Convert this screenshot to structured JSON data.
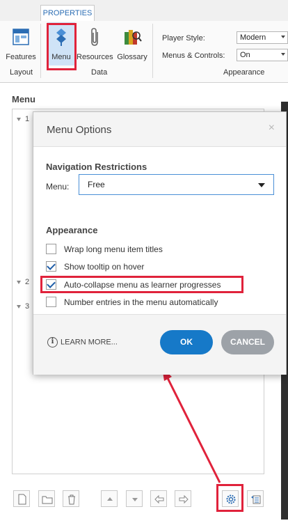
{
  "ribbon": {
    "tab_label": "PROPERTIES",
    "buttons": {
      "features": "Features",
      "menu": "Menu",
      "resources": "Resources",
      "glossary": "Glossary"
    },
    "groups": {
      "layout": "Layout",
      "data": "Data",
      "appearance": "Appearance"
    },
    "player_style": {
      "label": "Player Style:",
      "value": "Modern"
    },
    "menus_controls": {
      "label": "Menus & Controls:",
      "value": "On"
    }
  },
  "panel": {
    "title": "Menu",
    "tree_items": [
      "1",
      "2",
      "3"
    ]
  },
  "dialog": {
    "title": "Menu Options",
    "close_glyph": "×",
    "navigation": {
      "title": "Navigation Restrictions",
      "menu_label": "Menu:",
      "menu_value": "Free"
    },
    "appearance": {
      "title": "Appearance",
      "options": [
        {
          "label": "Wrap long menu item titles",
          "checked": false
        },
        {
          "label": "Show tooltip on hover",
          "checked": true
        },
        {
          "label": "Auto-collapse menu as learner progresses",
          "checked": true
        },
        {
          "label": "Number entries in the menu automatically",
          "checked": false
        }
      ]
    },
    "learn_more": "LEARN MORE...",
    "ok_label": "OK",
    "cancel_label": "CANCEL"
  },
  "colors": {
    "accent": "#1679c8",
    "highlight": "#e0223b",
    "selected": "#cfe3f7"
  }
}
